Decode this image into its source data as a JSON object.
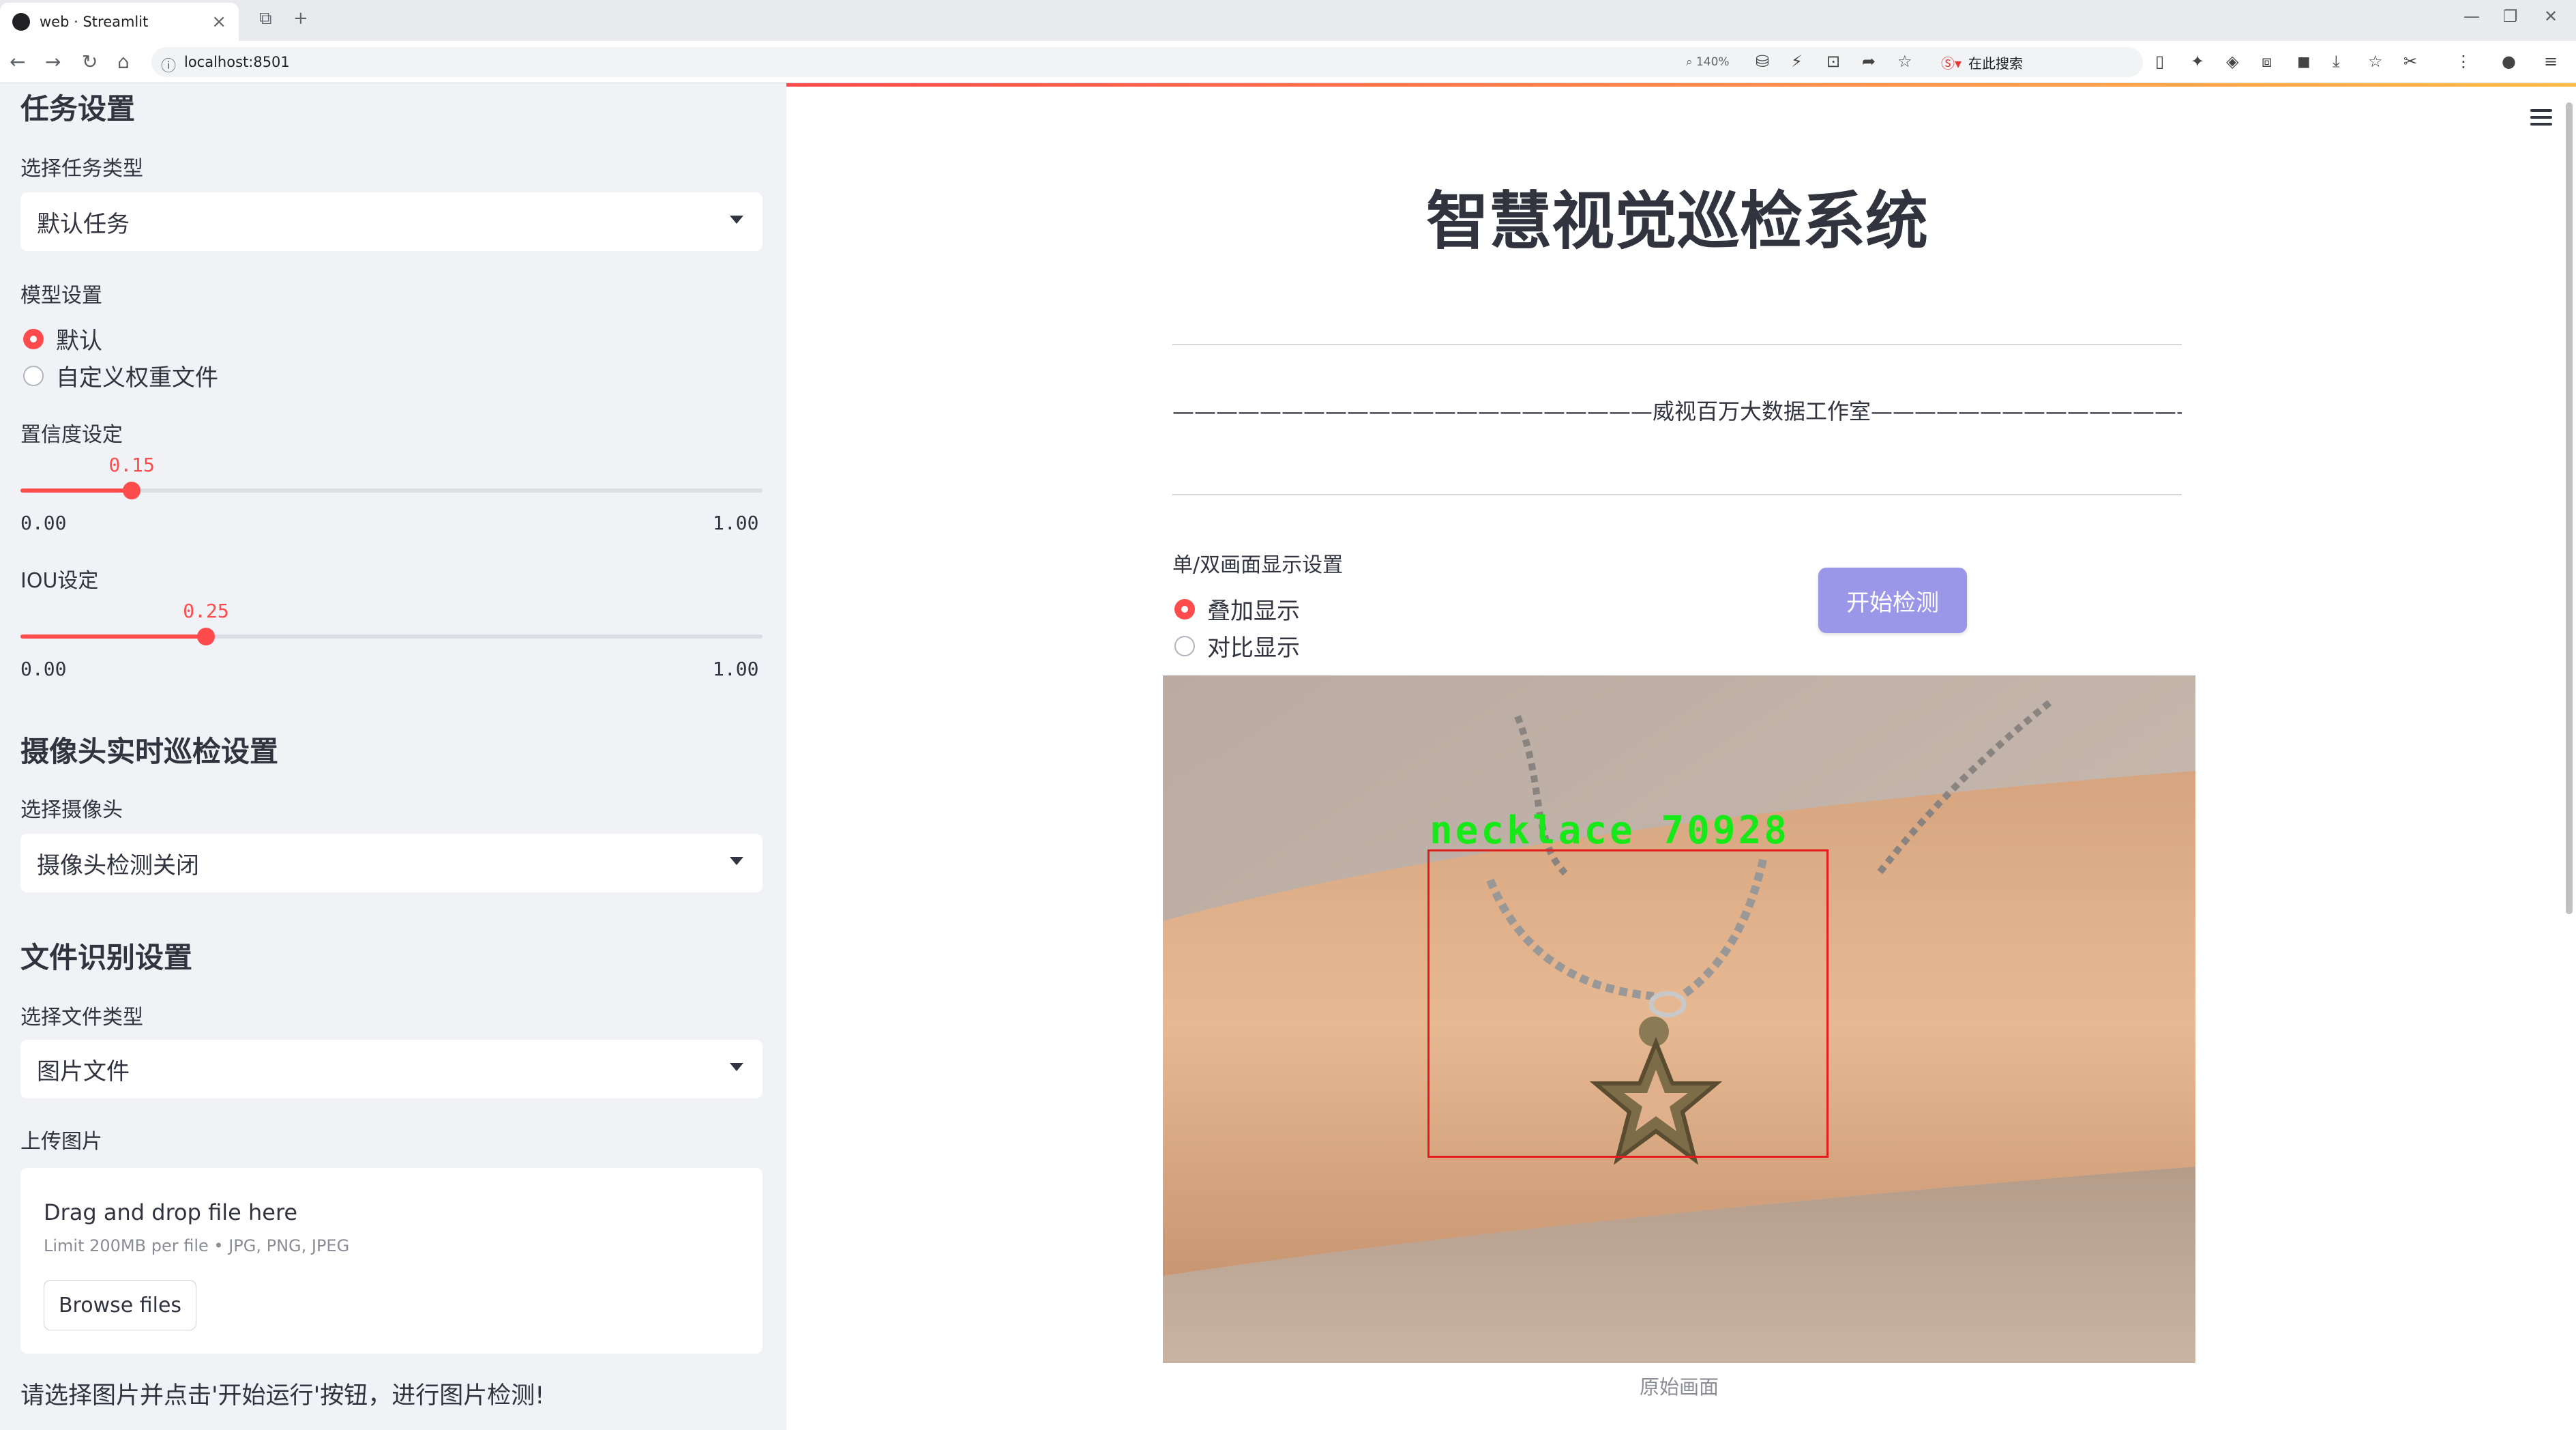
{
  "browser": {
    "tab_title": "web · Streamlit",
    "url": "localhost:8501",
    "zoom": "140%",
    "search_engine_label": "在此搜索"
  },
  "sidebar": {
    "task_section": {
      "heading": "任务设置",
      "task_type_label": "选择任务类型",
      "task_type_value": "默认任务"
    },
    "model_section": {
      "label": "模型设置",
      "options": [
        "默认",
        "自定义权重文件"
      ],
      "selected": "默认"
    },
    "confidence": {
      "label": "置信度设定",
      "value": "0.15",
      "value_num": 0.15,
      "min": "0.00",
      "max": "1.00"
    },
    "iou": {
      "label": "IOU设定",
      "value": "0.25",
      "value_num": 0.25,
      "min": "0.00",
      "max": "1.00"
    },
    "camera_section": {
      "heading": "摄像头实时巡检设置",
      "label": "选择摄像头",
      "value": "摄像头检测关闭"
    },
    "file_section": {
      "heading": "文件识别设置",
      "label": "选择文件类型",
      "value": "图片文件"
    },
    "upload": {
      "label": "上传图片",
      "drop_text": "Drag and drop file here",
      "limit_text": "Limit 200MB per file • JPG, PNG, JPEG",
      "browse_label": "Browse files"
    },
    "note": "请选择图片并点击'开始运行'按钮，进行图片检测!"
  },
  "main": {
    "title": "智慧视觉巡检系统",
    "subtitle": "——————————————————————威视百万大数据工作室————————————————————————",
    "display_mode": {
      "label": "单/双画面显示设置",
      "options": [
        "叠加显示",
        "对比显示"
      ],
      "selected": "叠加显示"
    },
    "start_button": "开始检测",
    "detection_label": "necklace 70928",
    "caption": "原始画面"
  },
  "colors": {
    "accent": "#ff4b4b",
    "button": "#9b97e8",
    "detection_box": "#e41c1c",
    "detection_text": "#17e817"
  }
}
